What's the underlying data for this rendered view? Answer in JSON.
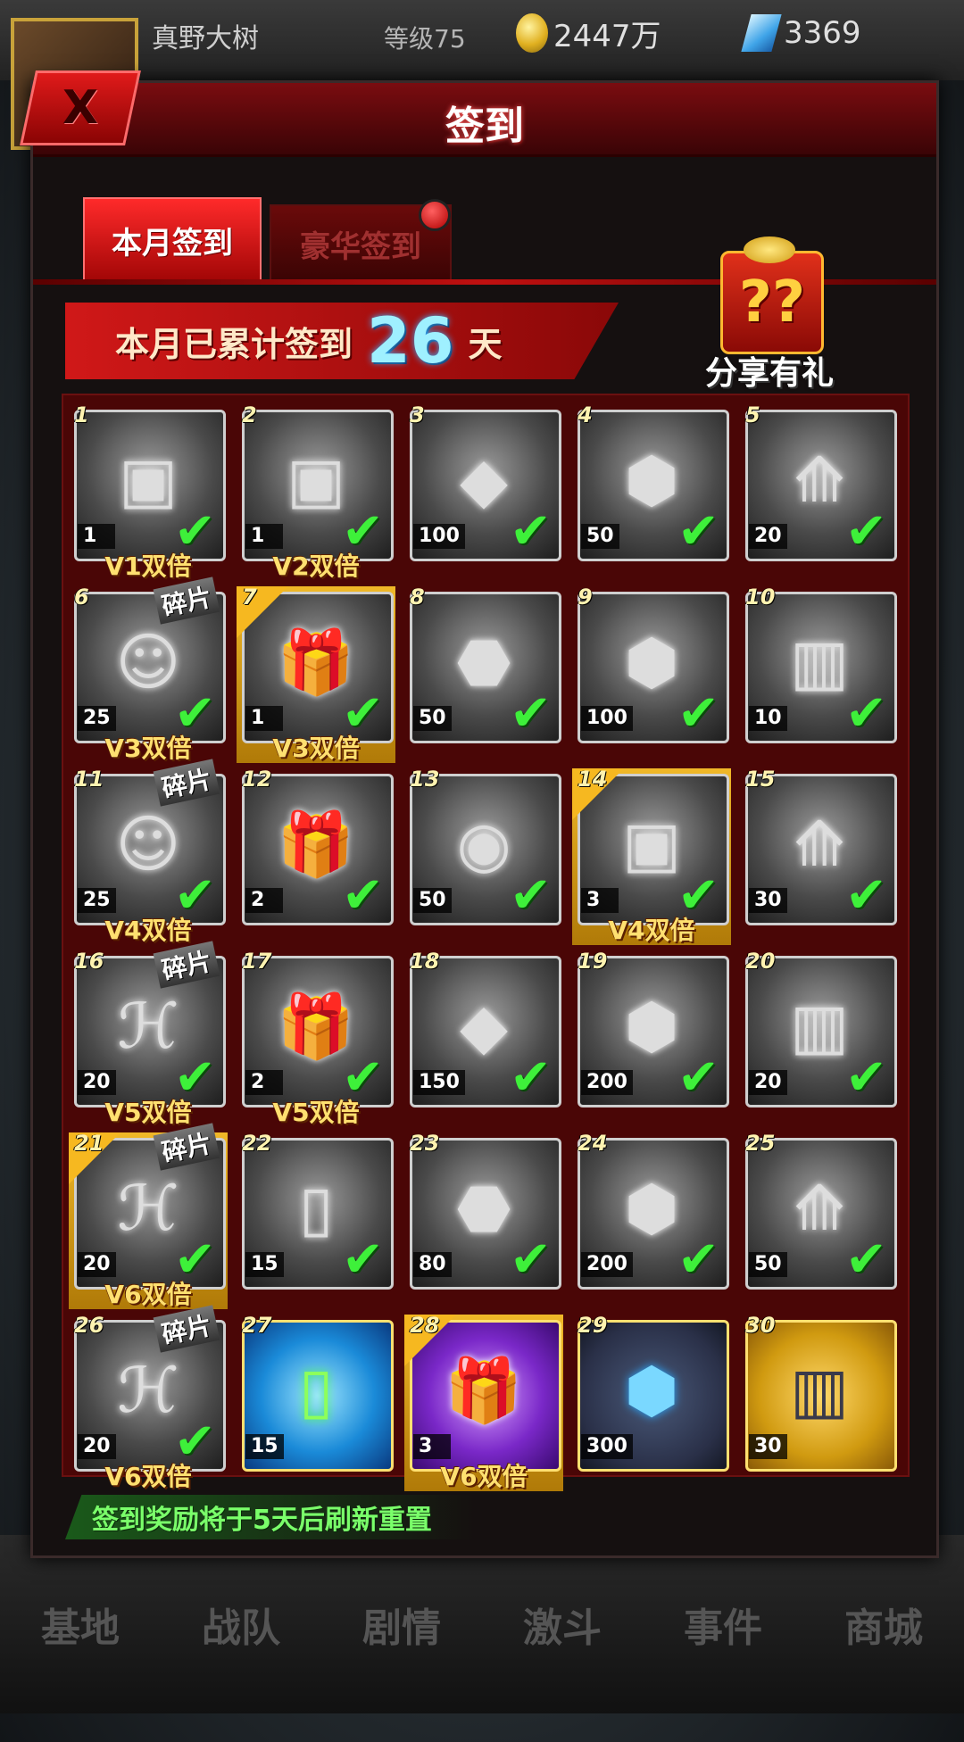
{
  "status": {
    "player_name": "真野大树",
    "level": "等级75",
    "coins": "2447万",
    "gems": "3369"
  },
  "bottom_nav": [
    "基地",
    "战队",
    "剧情",
    "激斗",
    "事件",
    "商城"
  ],
  "dialog": {
    "title": "签到",
    "close_label": "X",
    "tabs": {
      "active": "本月签到",
      "inactive": "豪华签到"
    },
    "banner": {
      "prefix": "本月已累计签到",
      "days": "26",
      "suffix": "天"
    },
    "share_label": "分享有礼",
    "share_glyph": "??",
    "footer": "签到奖励将于5天后刷新重置",
    "checkmark": "✔",
    "fragment_label": "碎片"
  },
  "days": [
    {
      "day": "1",
      "qty": "1",
      "icon": "chest-icon",
      "glyph": "▣",
      "signed": true,
      "bonus": "V1双倍"
    },
    {
      "day": "2",
      "qty": "1",
      "icon": "dark-chest-icon",
      "glyph": "▣",
      "signed": true,
      "bonus": "V2双倍"
    },
    {
      "day": "3",
      "qty": "100",
      "icon": "drop-crystal-icon",
      "glyph": "◆",
      "signed": true,
      "bonus": ""
    },
    {
      "day": "4",
      "qty": "50",
      "icon": "crystal-icon",
      "glyph": "⬢",
      "signed": true,
      "bonus": ""
    },
    {
      "day": "5",
      "qty": "20",
      "icon": "upgrade-chest-icon",
      "glyph": "⟰",
      "signed": true,
      "bonus": ""
    },
    {
      "day": "6",
      "qty": "25",
      "icon": "ultraman-fragment-icon",
      "glyph": "☺",
      "signed": true,
      "bonus": "V3双倍",
      "fragment": true
    },
    {
      "day": "7",
      "qty": "1",
      "icon": "gift-box-icon",
      "glyph": "🎁",
      "signed": true,
      "bonus": "V3双倍",
      "highlight": true
    },
    {
      "day": "8",
      "qty": "50",
      "icon": "dark-stone-icon",
      "glyph": "⬣",
      "signed": true,
      "bonus": ""
    },
    {
      "day": "9",
      "qty": "100",
      "icon": "crystal-icon",
      "glyph": "⬢",
      "signed": true,
      "bonus": ""
    },
    {
      "day": "10",
      "qty": "10",
      "icon": "armor-chip-icon",
      "glyph": "▥",
      "signed": true,
      "bonus": ""
    },
    {
      "day": "11",
      "qty": "25",
      "icon": "ultraman-fragment-icon",
      "glyph": "☺",
      "signed": true,
      "bonus": "V4双倍",
      "fragment": true
    },
    {
      "day": "12",
      "qty": "2",
      "icon": "gift-box-icon",
      "glyph": "🎁",
      "signed": true,
      "bonus": ""
    },
    {
      "day": "13",
      "qty": "50",
      "icon": "orb-stone-icon",
      "glyph": "◉",
      "signed": true,
      "bonus": ""
    },
    {
      "day": "14",
      "qty": "3",
      "icon": "chest-icon",
      "glyph": "▣",
      "signed": true,
      "bonus": "V4双倍",
      "highlight": true
    },
    {
      "day": "15",
      "qty": "30",
      "icon": "upgrade-chest-icon",
      "glyph": "⟰",
      "signed": true,
      "bonus": ""
    },
    {
      "day": "16",
      "qty": "20",
      "icon": "emblem-fragment-icon",
      "glyph": "ℋ",
      "signed": true,
      "bonus": "V5双倍",
      "fragment": true
    },
    {
      "day": "17",
      "qty": "2",
      "icon": "gift-box-icon",
      "glyph": "🎁",
      "signed": true,
      "bonus": "V5双倍"
    },
    {
      "day": "18",
      "qty": "150",
      "icon": "drop-crystal-icon",
      "glyph": "◆",
      "signed": true,
      "bonus": ""
    },
    {
      "day": "19",
      "qty": "200",
      "icon": "crystal-icon",
      "glyph": "⬢",
      "signed": true,
      "bonus": ""
    },
    {
      "day": "20",
      "qty": "20",
      "icon": "armor-chip-icon",
      "glyph": "▥",
      "signed": true,
      "bonus": ""
    },
    {
      "day": "21",
      "qty": "20",
      "icon": "emblem-fragment-icon",
      "glyph": "ℋ",
      "signed": true,
      "bonus": "V6双倍",
      "fragment": true,
      "highlight": true
    },
    {
      "day": "22",
      "qty": "15",
      "icon": "potion-vial-icon",
      "glyph": "▯",
      "signed": true,
      "bonus": ""
    },
    {
      "day": "23",
      "qty": "80",
      "icon": "dark-stone-icon",
      "glyph": "⬣",
      "signed": true,
      "bonus": ""
    },
    {
      "day": "24",
      "qty": "200",
      "icon": "crystal-icon",
      "glyph": "⬢",
      "signed": true,
      "bonus": ""
    },
    {
      "day": "25",
      "qty": "50",
      "icon": "upgrade-chest-icon",
      "glyph": "⟰",
      "signed": true,
      "bonus": ""
    },
    {
      "day": "26",
      "qty": "20",
      "icon": "emblem-fragment-icon",
      "glyph": "ℋ",
      "signed": true,
      "bonus": "V6双倍",
      "fragment": true
    },
    {
      "day": "27",
      "qty": "15",
      "icon": "green-potion-icon",
      "glyph": "▯",
      "signed": false,
      "bonus": "",
      "style": "blue"
    },
    {
      "day": "28",
      "qty": "3",
      "icon": "gift-box-icon",
      "glyph": "🎁",
      "signed": false,
      "bonus": "V6双倍",
      "style": "purple",
      "highlight": true
    },
    {
      "day": "29",
      "qty": "300",
      "icon": "blue-crystal-icon",
      "glyph": "⬢",
      "signed": false,
      "bonus": "",
      "style": "gold"
    },
    {
      "day": "30",
      "qty": "30",
      "icon": "armor-chip-icon",
      "glyph": "▥",
      "signed": false,
      "bonus": "",
      "style": "gold2"
    }
  ]
}
